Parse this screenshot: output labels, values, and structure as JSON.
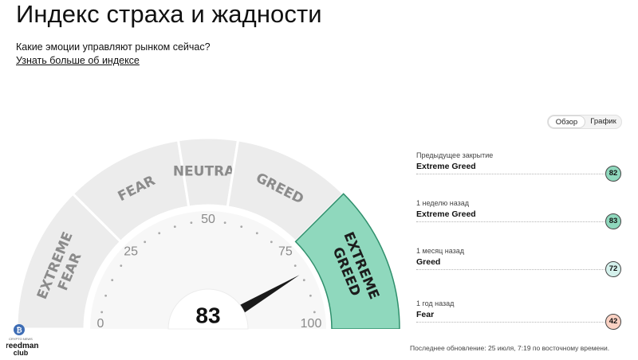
{
  "header": {
    "title": "Индекс страха и жадности",
    "subtitle": "Какие эмоции управляют рынком сейчас?",
    "link": "Узнать больше об индексе"
  },
  "toggle": {
    "overview": "Обзор",
    "chart": "График"
  },
  "gauge": {
    "value": 83,
    "value_text": "83",
    "range": [
      0,
      100
    ],
    "segments": [
      {
        "label_lines": [
          "EXTREME",
          "FEAR"
        ],
        "from": 0,
        "to": 25,
        "active": false
      },
      {
        "label_lines": [
          "FEAR"
        ],
        "from": 25,
        "to": 45,
        "active": false
      },
      {
        "label_lines": [
          "NEUTRAL"
        ],
        "from": 45,
        "to": 55,
        "active": false
      },
      {
        "label_lines": [
          "GREED"
        ],
        "from": 55,
        "to": 75,
        "active": false
      },
      {
        "label_lines": [
          "EXTREME",
          "GREED"
        ],
        "from": 75,
        "to": 100,
        "active": true
      }
    ],
    "scale_labels": [
      {
        "value": 0,
        "text": "0"
      },
      {
        "value": 25,
        "text": "25"
      },
      {
        "value": 50,
        "text": "50"
      },
      {
        "value": 75,
        "text": "75"
      },
      {
        "value": 100,
        "text": "100"
      }
    ],
    "colors": {
      "band": "#ececec",
      "band_active": "#8fd8bd",
      "band_active_border": "#2f8f6c",
      "inner": "#f7f7f7",
      "label": "#8b8b8b",
      "label_active": "#1c1c1c",
      "needle": "#1a1a1a",
      "dots": "#a8a8a8"
    }
  },
  "history": [
    {
      "label": "Предыдущее закрытие",
      "status": "Extreme Greed",
      "value": "82",
      "color": "#8fd8bd"
    },
    {
      "label": "1 неделю назад",
      "status": "Extreme Greed",
      "value": "83",
      "color": "#8fd8bd"
    },
    {
      "label": "1 месяц назад",
      "status": "Greed",
      "value": "72",
      "color": "#d4f1ec"
    },
    {
      "label": "1 год назад",
      "status": "Fear",
      "value": "42",
      "color": "#fbd2c4"
    }
  ],
  "updated": "Последнее обновление: 25 июля, 7:19 по восточному времени.",
  "logo": {
    "top_text": "CRYPTO NEWS",
    "brand_line1": "freedman",
    "brand_line2": "club",
    "coin_icon": "bitcoin-icon"
  }
}
